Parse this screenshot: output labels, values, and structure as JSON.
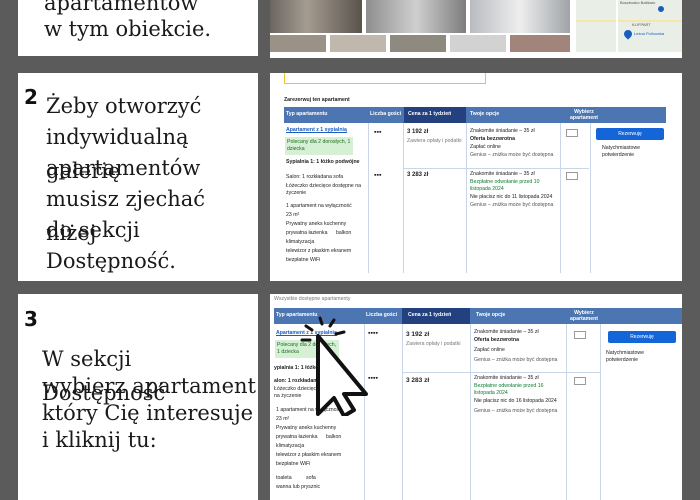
{
  "step1": {
    "text_line1": "apartamentów",
    "text_line2": "w tym obiekcie.",
    "map_label": "KLIFPART",
    "map_label2": "Boszbosko Batikaru",
    "map_marker": "Leśna Polinowka"
  },
  "step2": {
    "number": "2",
    "text": [
      "Żeby otworzyć",
      "indywidualną galerię",
      "apartamentów",
      "musisz zjechać niżej",
      "do sekcji",
      "Dostępność."
    ],
    "section_title": "Zarezerwuj ten apartament",
    "headers": [
      "Typ apartamentu",
      "Liczba gości",
      "Cena za 1 tydzień",
      "Twoje opcje",
      "Wybierz apartament"
    ],
    "apartment_link": "Apartament z 1 sypialnią",
    "recommended": "Polecany dla 2 dorosłych, 1 dziecka",
    "bedroom": "Sypialnia 1: 1 łóżko podwójne",
    "living": "Salon: 1 rozkładana sofa",
    "crib": "Łóżeczko dziecięce dostępne na życzenie",
    "features": [
      "1 apartament na wyłączność",
      "23 m²",
      "Prywatny aneks kuchenny",
      "prywatna łazienka",
      "balkon",
      "klimatyzacja",
      "telewizor z płaskim ekranem",
      "bezpłatne WiFi"
    ],
    "price1": "3 192 zł",
    "price1_note": "Zawiera opłaty i podatki",
    "price2": "3 283 zł",
    "options1": [
      "Znakomite śniadanie – 35 zł",
      "Oferta bezzwrotna",
      "Zapłać online",
      "Genius – zniżka może być dostępna"
    ],
    "options2": [
      "Znakomite śniadanie – 35 zł",
      "Bezpłatne odwołanie przed 10 listopada 2024",
      "Nie płacisz nic do 11 listopada 2024",
      "Genius – zniżka może być dostępna"
    ],
    "reserve": "Rezerwuję",
    "instant": "Natychmiastowe potwierdzenie"
  },
  "step3": {
    "number": "3",
    "text": [
      "W sekcji Dostępność",
      "wybierz apartament",
      "który Cię interesuje",
      "i kliknij tu:"
    ],
    "section_title": "Wszystkie dostępne apartamenty",
    "headers": [
      "Typ apartamentu",
      "Liczba gości",
      "Cena za 1 tydzień",
      "Twoje opcje",
      "Wybierz apartament"
    ],
    "apartment_link": "Apartament z 1 sypialnią",
    "recommended": "Polecany dla 2 dorosłych, 1 dziecka",
    "bedroom": "ypialnia 1: 1 łóżko podwójne",
    "living": "alon: 1 rozkładana sofa",
    "crib": "Łóżeczko dziecięce dostępne na życzenie",
    "features": [
      "1 apartament na wyłączność",
      "23 m²",
      "Prywatny aneks kuchenny",
      "prywatna łazienka",
      "balkon",
      "klimatyzacja",
      "telewizor z płaskim ekranem",
      "bezpłatne WiFi"
    ],
    "price1": "3 192 zł",
    "price1_note": "Zawiera opłaty i podatki",
    "price2": "3 283 zł",
    "options1": [
      "Znakomite śniadanie – 35 zł",
      "Oferta bezzwrotna",
      "Zapłać online",
      "Genius – zniżka może być dostępna"
    ],
    "options2": [
      "Znakomite śniadanie – 35 zł",
      "Bezpłatne odwołanie przed 16 listopada 2024",
      "Nie płacisz nic do 16 listopada 2024",
      "Genius – zniżka może być dostępna"
    ],
    "reserve": "Rezerwuję",
    "instant": "Natychmiastowe potwierdzenie",
    "extra": [
      "toaleta",
      "sofa",
      "wanna lub prysznic"
    ]
  },
  "colors": {
    "header_blue": "#4c76b2",
    "header_dark": "#23407f",
    "button": "#1466d8",
    "link": "#1a5dc0",
    "green": "#0a7c2c"
  }
}
